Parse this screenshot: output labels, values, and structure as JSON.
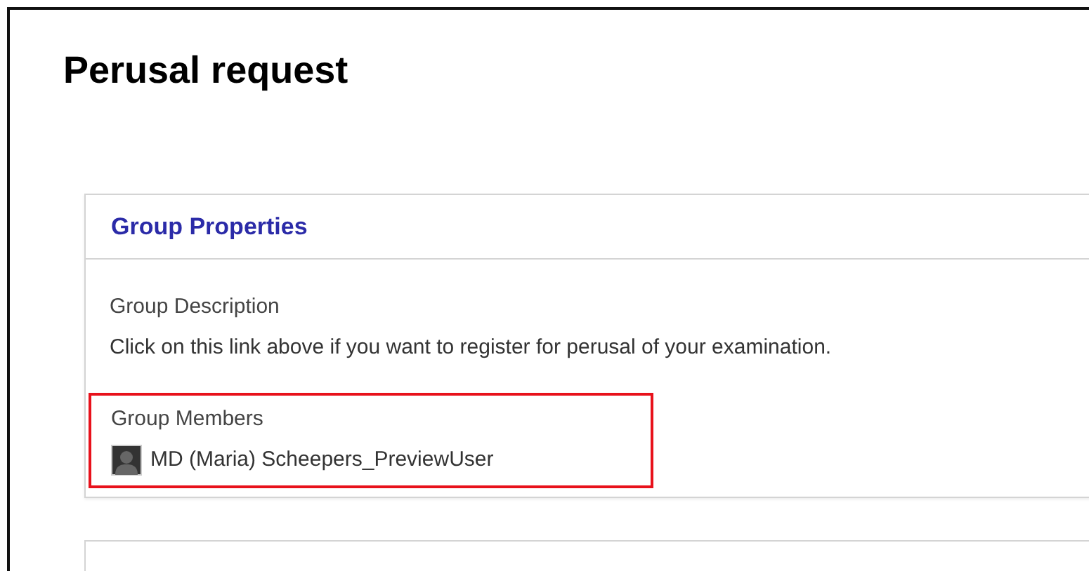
{
  "page": {
    "title": "Perusal request"
  },
  "group_properties": {
    "heading": "Group Properties",
    "description": {
      "label": "Group Description",
      "text": "Click on this link above if you want to register for perusal of your examination."
    },
    "members": {
      "label": "Group Members",
      "highlighted": true,
      "items": [
        {
          "name": "MD (Maria) Scheepers_PreviewUser"
        }
      ]
    }
  }
}
